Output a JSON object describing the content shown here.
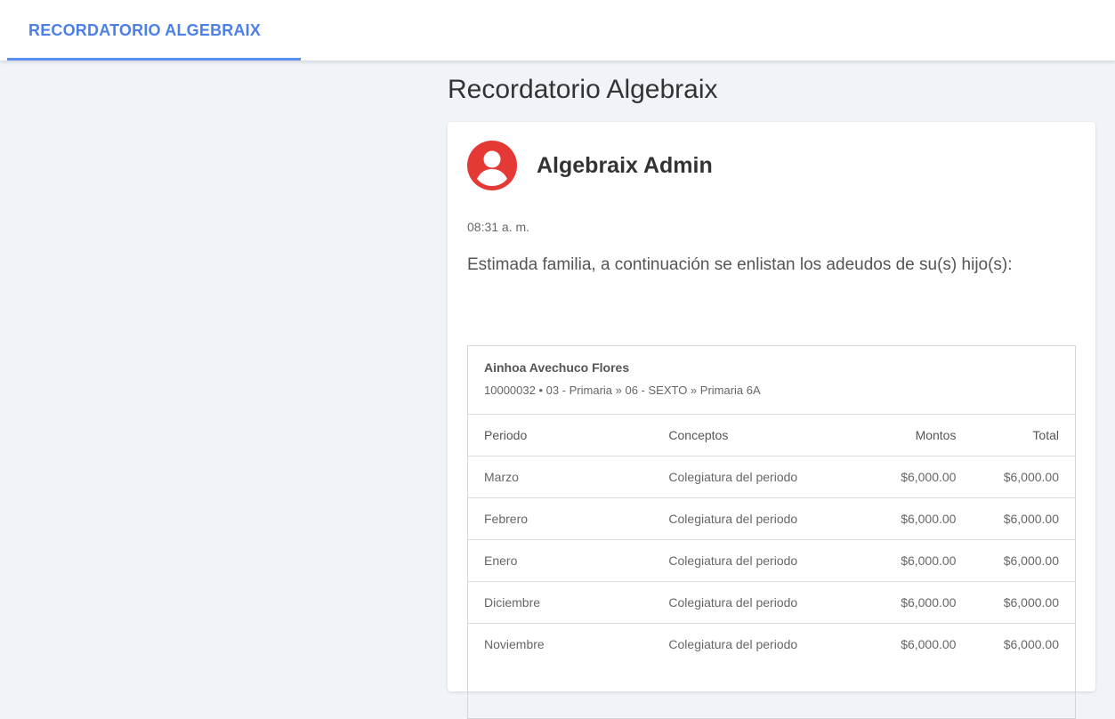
{
  "header": {
    "tab_label": "RECORDATORIO ALGEBRAIX"
  },
  "page": {
    "title": "Recordatorio Algebraix"
  },
  "message": {
    "sender": "Algebraix Admin",
    "time": "08:31 a. m.",
    "intro": "Estimada familia, a continuación se enlistan los adeudos de su(s) hijo(s):",
    "avatar_icon": "user-circle-icon",
    "avatar_color": "#e53935"
  },
  "student": {
    "name": "Ainhoa Avechuco Flores",
    "info": "10000032 • 03 - Primaria » 06 - SEXTO » Primaria 6A"
  },
  "table": {
    "headers": {
      "periodo": "Periodo",
      "conceptos": "Conceptos",
      "montos": "Montos",
      "total": "Total"
    },
    "rows": [
      {
        "periodo": "Marzo",
        "concepto": "Colegiatura del periodo",
        "monto": "$6,000.00",
        "total": "$6,000.00"
      },
      {
        "periodo": "Febrero",
        "concepto": "Colegiatura del periodo",
        "monto": "$6,000.00",
        "total": "$6,000.00"
      },
      {
        "periodo": "Enero",
        "concepto": "Colegiatura del periodo",
        "monto": "$6,000.00",
        "total": "$6,000.00"
      },
      {
        "periodo": "Diciembre",
        "concepto": "Colegiatura del periodo",
        "monto": "$6,000.00",
        "total": "$6,000.00"
      },
      {
        "periodo": "Noviembre",
        "concepto": "Colegiatura del periodo",
        "monto": "$6,000.00",
        "total": "$6,000.00"
      }
    ]
  },
  "colors": {
    "accent": "#4d80e6",
    "background": "#f0f4f9"
  }
}
